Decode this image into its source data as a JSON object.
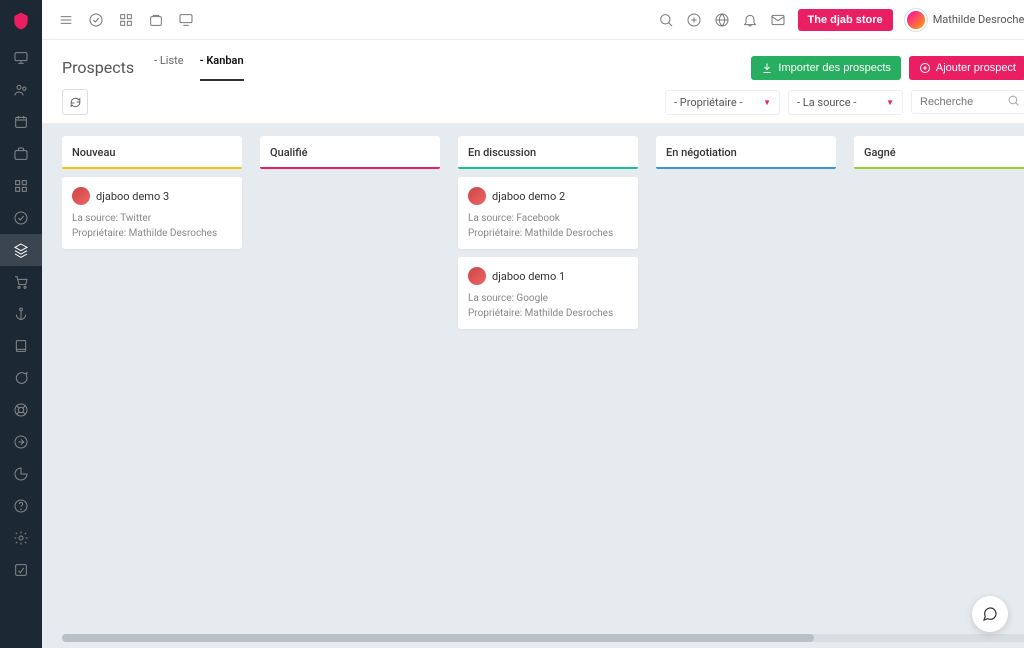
{
  "brand_color": "#e91e63",
  "topbar": {
    "store_label": "The djab store",
    "user_name": "Mathilde Desroches"
  },
  "header": {
    "title": "Prospects",
    "tabs": [
      {
        "label": "- Liste",
        "active": false
      },
      {
        "label": "- Kanban",
        "active": true
      }
    ],
    "import_label": "Importer des prospects",
    "add_label": "Ajouter prospect"
  },
  "filters": {
    "owner_dropdown": "- Propriétaire -",
    "source_dropdown": "- La source -",
    "search_placeholder": "Recherche"
  },
  "columns": [
    {
      "name": "Nouveau",
      "color": "#f1c40f",
      "cards": [
        {
          "title": "djaboo demo 3",
          "source": "La source: Twitter",
          "owner": "Propriétaire: Mathilde Desroches"
        }
      ]
    },
    {
      "name": "Qualifié",
      "color": "#e91e63",
      "cards": []
    },
    {
      "name": "En discussion",
      "color": "#1abc9c",
      "cards": [
        {
          "title": "djaboo demo 2",
          "source": "La source: Facebook",
          "owner": "Propriétaire: Mathilde Desroches"
        },
        {
          "title": "djaboo demo 1",
          "source": "La source: Google",
          "owner": "Propriétaire: Mathilde Desroches"
        }
      ]
    },
    {
      "name": "En négotiation",
      "color": "#3498db",
      "cards": []
    },
    {
      "name": "Gagné",
      "color": "#9acd32",
      "cards": []
    }
  ]
}
